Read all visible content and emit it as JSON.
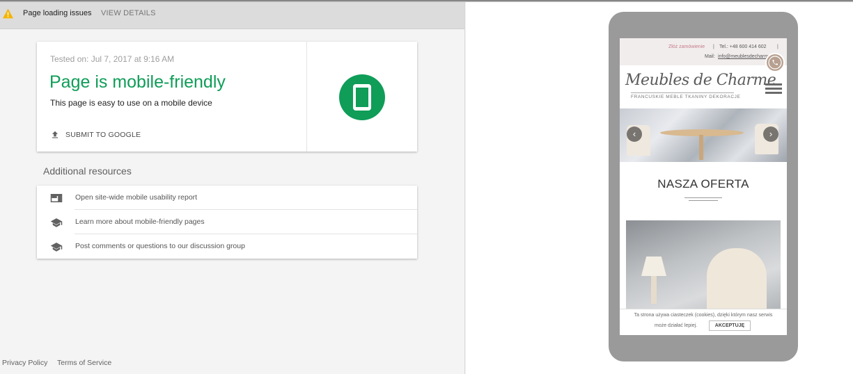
{
  "banner": {
    "text": "Page loading issues",
    "link": "VIEW DETAILS"
  },
  "result": {
    "tested_on": "Tested on: Jul 7, 2017 at 9:16 AM",
    "title": "Page is mobile-friendly",
    "description": "This page is easy to use on a mobile device",
    "submit_label": "SUBMIT TO GOOGLE"
  },
  "additional": {
    "title": "Additional resources",
    "items": [
      {
        "label": "Open site-wide mobile usability report",
        "icon": "report-icon"
      },
      {
        "label": "Learn more about mobile-friendly pages",
        "icon": "school-icon"
      },
      {
        "label": "Post comments or questions to our discussion group",
        "icon": "school-icon"
      }
    ]
  },
  "footer": {
    "privacy": "Privacy Policy",
    "terms": "Terms of Service"
  },
  "phone_preview": {
    "order_link": "Złóż zamówienie",
    "sep": "|",
    "tel": "Tel.: +48 600 414 602",
    "mail_label": "Mail:",
    "mail": "info@meublesdecharme.pl",
    "logo": "Meubles de Charme",
    "tagline": "FRANCUSKIE MEBLE TKANINY DEKORACJE",
    "heading": "NASZA OFERTA",
    "cookie_line1": "Ta strona używa ciasteczek (cookies), dzięki którym nasz serwis",
    "cookie_line2": "może działać lepiej.",
    "accept": "AKCEPTUJĘ",
    "arrow_left": "‹",
    "arrow_right": "›"
  },
  "colors": {
    "success": "#0f9d58",
    "warning": "#f4b400",
    "text_muted": "#757575"
  }
}
